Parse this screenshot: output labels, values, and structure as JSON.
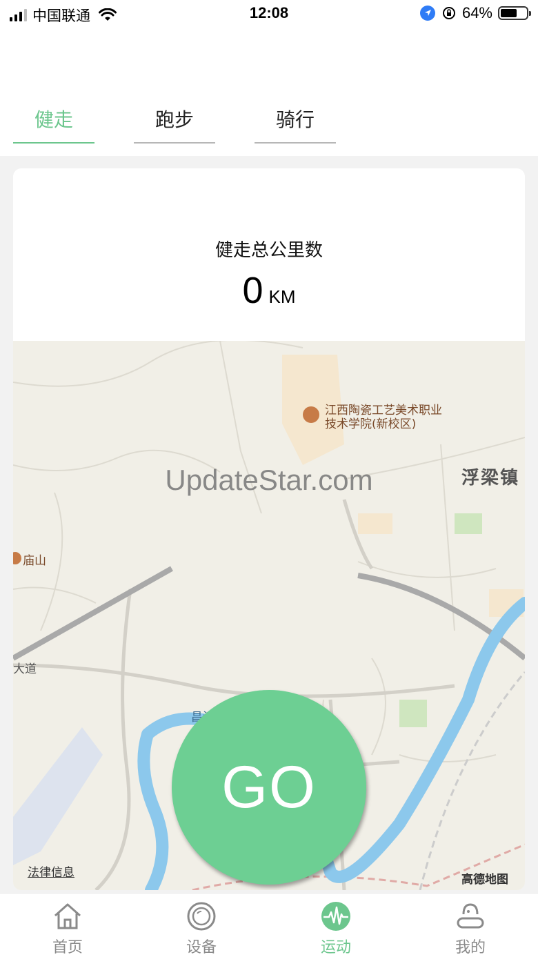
{
  "status_bar": {
    "carrier": "中国联通",
    "time": "12:08",
    "battery": "64%",
    "battery_level": 0.64
  },
  "tabs": [
    {
      "label": "健走",
      "active": true
    },
    {
      "label": "跑步",
      "active": false
    },
    {
      "label": "骑行",
      "active": false
    }
  ],
  "summary": {
    "label": "健走总公里数",
    "value": "0",
    "unit": "KM"
  },
  "map": {
    "poi_school_line1": "江西陶瓷工艺美术职业",
    "poi_school_line2": "技术学院(新校区)",
    "watermark": "UpdateStar.com",
    "town": "浮梁镇",
    "poi_temple": "庙山",
    "road": "大道",
    "river": "昌江",
    "legal": "法律信息",
    "provider": "高德地图"
  },
  "go_button": {
    "label": "GO"
  },
  "bottom_nav": [
    {
      "label": "首页",
      "icon": "home-icon",
      "active": false
    },
    {
      "label": "设备",
      "icon": "device-icon",
      "active": false
    },
    {
      "label": "运动",
      "icon": "sport-icon",
      "active": true
    },
    {
      "label": "我的",
      "icon": "profile-icon",
      "active": false
    }
  ],
  "colors": {
    "accent": "#6cc68d",
    "go_button": "#6dcf93",
    "river": "#8cc8ec"
  }
}
